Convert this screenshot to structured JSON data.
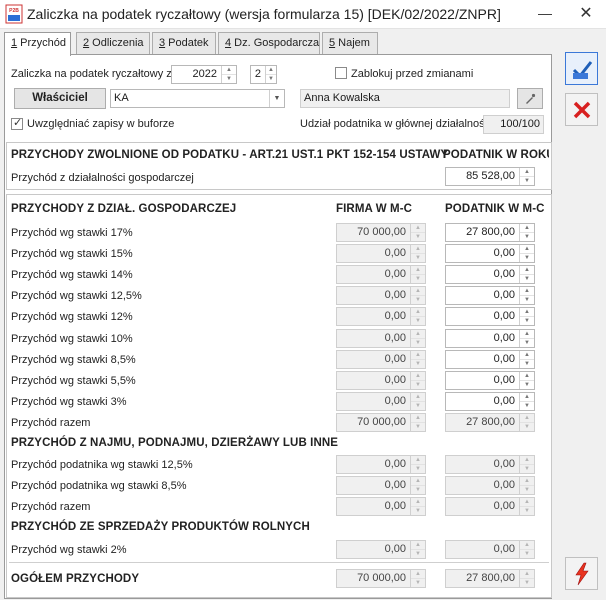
{
  "window": {
    "title": "Zaliczka na podatek ryczałtowy (wersja formularza 15) [DEK/02/2022/ZNPR]",
    "app_icon_text": "P2B",
    "minimize_glyph": "—",
    "close_glyph": "✕"
  },
  "tabs": [
    {
      "key": "1",
      "label": " Przychód"
    },
    {
      "key": "2",
      "label": " Odliczenia"
    },
    {
      "key": "3",
      "label": " Podatek"
    },
    {
      "key": "4",
      "label": " Dz. Gospodarcza"
    },
    {
      "key": "5",
      "label": " Najem"
    }
  ],
  "header": {
    "period_label": "Zaliczka na podatek ryczałtowy za:",
    "year": "2022",
    "month": "2",
    "lock_label": "Zablokuj przed zmianami",
    "owner_button": "Właściciel",
    "owner_code": "KA",
    "owner_name": "Anna Kowalska",
    "buffer_label": "Uwzględniać zapisy w buforze",
    "share_label": "Udział podatnika w głównej działalności",
    "share_value": "100/100"
  },
  "exempt": {
    "title": "PRZYCHODY ZWOLNIONE OD PODATKU - ART.21 UST.1 PKT 152-154 USTAWY",
    "col": "PODATNIK W ROKU",
    "row_label": "Przychód z działalności gospodarczej",
    "row_value": "85 528,00"
  },
  "business": {
    "title": "PRZYCHODY Z DZIAŁ. GOSPODARCZEJ",
    "col_firm": "FIRMA W M-C",
    "col_taxpayer": "PODATNIK W M-C",
    "rows": [
      {
        "label": "Przychód wg stawki 17%",
        "firm": "70 000,00",
        "taxpayer": "27 800,00"
      },
      {
        "label": "Przychód wg stawki 15%",
        "firm": "0,00",
        "taxpayer": "0,00"
      },
      {
        "label": "Przychód wg stawki 14%",
        "firm": "0,00",
        "taxpayer": "0,00"
      },
      {
        "label": "Przychód wg stawki 12,5%",
        "firm": "0,00",
        "taxpayer": "0,00"
      },
      {
        "label": "Przychód wg stawki 12%",
        "firm": "0,00",
        "taxpayer": "0,00"
      },
      {
        "label": "Przychód wg stawki 10%",
        "firm": "0,00",
        "taxpayer": "0,00"
      },
      {
        "label": "Przychód wg stawki 8,5%",
        "firm": "0,00",
        "taxpayer": "0,00"
      },
      {
        "label": "Przychód wg stawki 5,5%",
        "firm": "0,00",
        "taxpayer": "0,00"
      },
      {
        "label": "Przychód wg stawki 3%",
        "firm": "0,00",
        "taxpayer": "0,00"
      }
    ],
    "total_label": "Przychód razem",
    "total_firm": "70 000,00",
    "total_taxpayer": "27 800,00"
  },
  "rent": {
    "title": "PRZYCHÓD Z NAJMU, PODNAJMU, DZIERŻAWY LUB INNE",
    "rows": [
      {
        "label": "Przychód podatnika wg stawki 12,5%",
        "firm": "0,00",
        "taxpayer": "0,00"
      },
      {
        "label": "Przychód podatnika wg stawki 8,5%",
        "firm": "0,00",
        "taxpayer": "0,00"
      },
      {
        "label": "Przychód razem",
        "firm": "0,00",
        "taxpayer": "0,00"
      }
    ]
  },
  "farm": {
    "title": "PRZYCHÓD ZE SPRZEDAŻY PRODUKTÓW ROLNYCH",
    "rows": [
      {
        "label": "Przychód wg stawki 2%",
        "firm": "0,00",
        "taxpayer": "0,00"
      }
    ]
  },
  "grand_total": {
    "label": "OGÓŁEM PRZYCHODY",
    "firm": "70 000,00",
    "taxpayer": "27 800,00"
  },
  "colors": {
    "accent": "#3b78d8",
    "cancel": "#d82020",
    "save": "#1f5fb8"
  }
}
